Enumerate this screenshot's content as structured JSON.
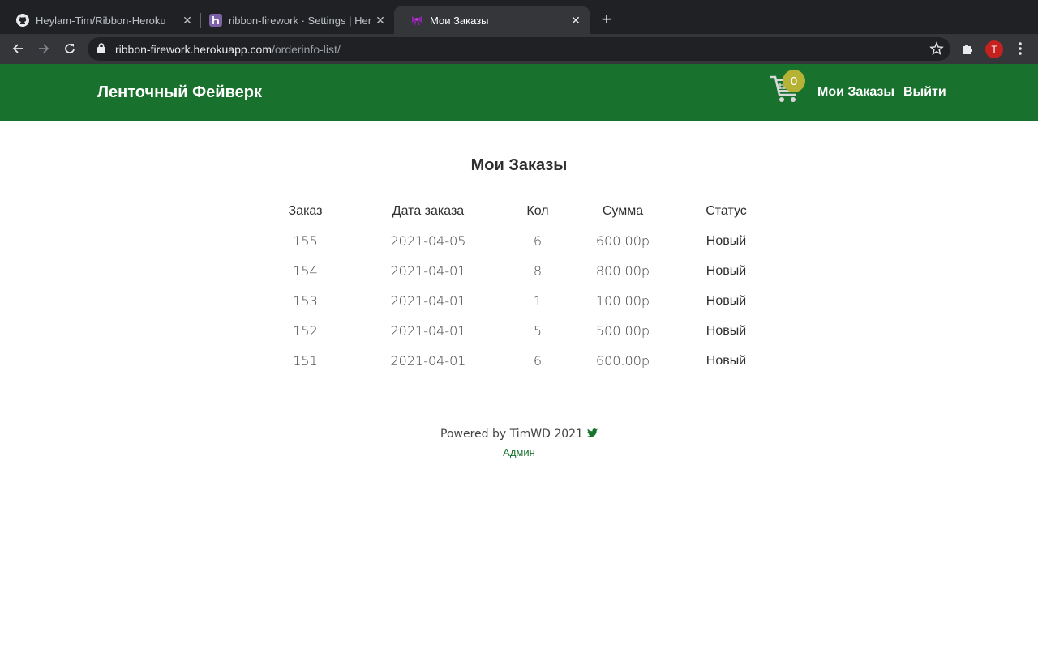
{
  "browser": {
    "tabs": [
      {
        "title": "Heylam-Tim/Ribbon-Heroku",
        "icon": "github-icon",
        "active": false
      },
      {
        "title": "ribbon-firework · Settings | Her",
        "icon": "heroku-icon",
        "active": false
      },
      {
        "title": "Мои Заказы",
        "icon": "ribbon-icon",
        "active": true
      }
    ],
    "url_domain": "ribbon-firework.herokuapp.com",
    "url_path": "/orderinfo-list/",
    "profile_initial": "T"
  },
  "header": {
    "brand": "Ленточный Фейверк",
    "cart_count": "0",
    "nav_orders": "Мои Заказы",
    "nav_logout": "Выйти",
    "bg_color": "#18722e"
  },
  "main": {
    "title": "Мои Заказы",
    "columns": [
      "Заказ",
      "Дата заказа",
      "Кол",
      "Сумма",
      "Статус"
    ],
    "rows": [
      {
        "order": "155",
        "date": "2021-04-05",
        "qty": "6",
        "sum": "600.00р",
        "status": "Новый"
      },
      {
        "order": "154",
        "date": "2021-04-01",
        "qty": "8",
        "sum": "800.00р",
        "status": "Новый"
      },
      {
        "order": "153",
        "date": "2021-04-01",
        "qty": "1",
        "sum": "100.00р",
        "status": "Новый"
      },
      {
        "order": "152",
        "date": "2021-04-01",
        "qty": "5",
        "sum": "500.00р",
        "status": "Новый"
      },
      {
        "order": "151",
        "date": "2021-04-01",
        "qty": "6",
        "sum": "600.00р",
        "status": "Новый"
      }
    ]
  },
  "footer": {
    "powered_by": "Powered by TimWD 2021",
    "admin_link": "Админ"
  }
}
